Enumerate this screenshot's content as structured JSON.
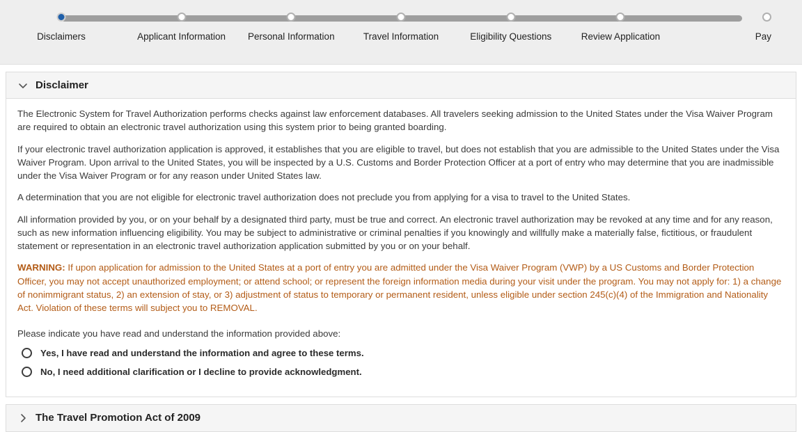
{
  "stepper": {
    "active_index": 0,
    "active_color": "#1f5fa9",
    "track_color": "#9e9e9e",
    "steps": [
      {
        "label": "Disclaimers",
        "state": "active"
      },
      {
        "label": "Applicant Information",
        "state": "inactive"
      },
      {
        "label": "Personal Information",
        "state": "inactive"
      },
      {
        "label": "Travel Information",
        "state": "inactive"
      },
      {
        "label": "Eligibility Questions",
        "state": "inactive"
      },
      {
        "label": "Review Application",
        "state": "inactive"
      },
      {
        "label": "Pay",
        "state": "inactive"
      }
    ]
  },
  "disclaimer_panel": {
    "title": "Disclaimer",
    "expanded": true,
    "chevron_icon": "chevron-down-icon",
    "paragraphs": [
      "The Electronic System for Travel Authorization performs checks against law enforcement databases. All travelers seeking admission to the United States under the Visa Waiver Program are required to obtain an electronic travel authorization using this system prior to being granted boarding.",
      "If your electronic travel authorization application is approved, it establishes that you are eligible to travel, but does not establish that you are admissible to the United States under the Visa Waiver Program. Upon arrival to the United States, you will be inspected by a U.S. Customs and Border Protection Officer at a port of entry who may determine that you are inadmissible under the Visa Waiver Program or for any reason under United States law.",
      "A determination that you are not eligible for electronic travel authorization does not preclude you from applying for a visa to travel to the United States.",
      "All information provided by you, or on your behalf by a designated third party, must be true and correct. An electronic travel authorization may be revoked at any time and for any reason, such as new information influencing eligibility. You may be subject to administrative or criminal penalties if you knowingly and willfully make a materially false, fictitious, or fraudulent statement or representation in an electronic travel authorization application submitted by you or on your behalf."
    ],
    "warning": {
      "color": "#b35c17",
      "label": "WARNING:",
      "text": " If upon application for admission to the United States at a port of entry you are admitted under the Visa Waiver Program (VWP) by a US Customs and Border Protection Officer, you may not accept unauthorized employment; or attend school; or represent the foreign information media during your visit under the program. You may not apply for: 1) a change of nonimmigrant status, 2) an extension of stay, or 3) adjustment of status to temporary or permanent resident, unless eligible under section 245(c)(4) of the Immigration and Nationality Act. Violation of these terms will subject you to REMOVAL."
    },
    "acknowledgment_prompt": "Please indicate you have read and understand the information provided above:",
    "options": [
      {
        "label": "Yes, I have read and understand the information and agree to these terms.",
        "selected": false
      },
      {
        "label": "No, I need additional clarification or I decline to provide acknowledgment.",
        "selected": false
      }
    ]
  },
  "travel_promotion_panel": {
    "title": "The Travel Promotion Act of 2009",
    "expanded": false,
    "chevron_icon": "chevron-right-icon"
  }
}
